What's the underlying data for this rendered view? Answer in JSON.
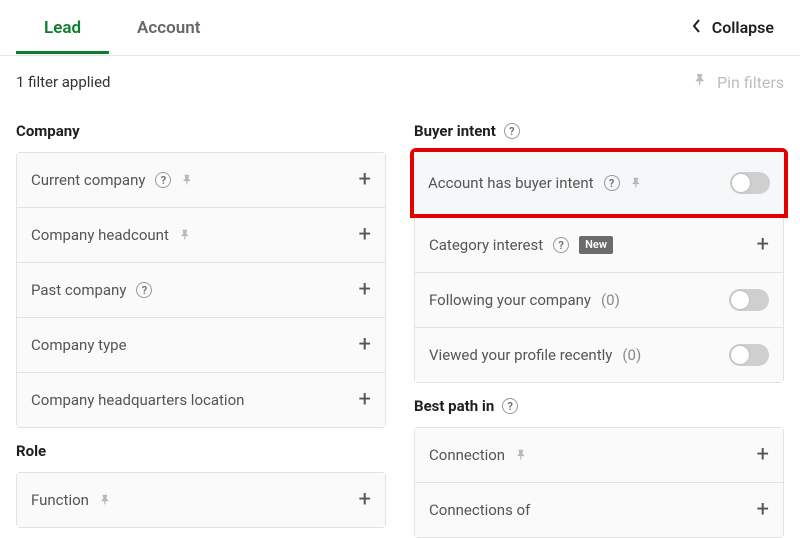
{
  "tabs": {
    "lead": "Lead",
    "account": "Account"
  },
  "header": {
    "collapse": "Collapse",
    "filter_count": "1 filter applied",
    "pin_filters": "Pin filters"
  },
  "sections": {
    "company": {
      "title": "Company",
      "rows": {
        "current_company": "Current company",
        "headcount": "Company headcount",
        "past_company": "Past company",
        "company_type": "Company type",
        "hq_location": "Company headquarters location"
      }
    },
    "role": {
      "title": "Role",
      "rows": {
        "function": "Function"
      }
    },
    "buyer_intent": {
      "title": "Buyer intent",
      "rows": {
        "account_has_buyer_intent": "Account has buyer intent",
        "category_interest": "Category interest",
        "category_interest_badge": "New",
        "following_company": "Following your company",
        "following_company_count": "(0)",
        "viewed_profile": "Viewed your profile recently",
        "viewed_profile_count": "(0)"
      }
    },
    "best_path": {
      "title": "Best path in",
      "rows": {
        "connection": "Connection",
        "connections_of": "Connections of"
      }
    }
  }
}
